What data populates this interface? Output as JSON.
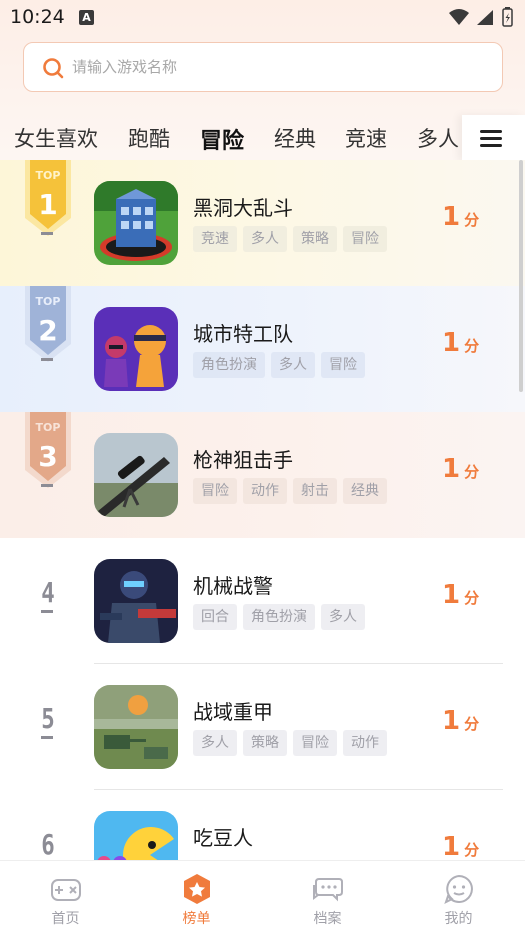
{
  "status_bar": {
    "time": "10:24",
    "app_badge": "A"
  },
  "search": {
    "placeholder": "请输入游戏名称"
  },
  "tabs": [
    {
      "label": "女生喜欢",
      "active": false
    },
    {
      "label": "跑酷",
      "active": false
    },
    {
      "label": "冒险",
      "active": true
    },
    {
      "label": "经典",
      "active": false
    },
    {
      "label": "竞速",
      "active": false
    },
    {
      "label": "多人",
      "active": false
    }
  ],
  "games": [
    {
      "rank": "1",
      "name": "黑洞大乱斗",
      "tags": [
        "竞速",
        "多人",
        "策略",
        "冒险"
      ],
      "score": "1",
      "score_unit": "分",
      "medal": "TOP"
    },
    {
      "rank": "2",
      "name": "城市特工队",
      "tags": [
        "角色扮演",
        "多人",
        "冒险"
      ],
      "score": "1",
      "score_unit": "分",
      "medal": "TOP"
    },
    {
      "rank": "3",
      "name": "枪神狙击手",
      "tags": [
        "冒险",
        "动作",
        "射击",
        "经典"
      ],
      "score": "1",
      "score_unit": "分",
      "medal": "TOP"
    },
    {
      "rank": "4",
      "name": "机械战警",
      "tags": [
        "回合",
        "角色扮演",
        "多人"
      ],
      "score": "1",
      "score_unit": "分"
    },
    {
      "rank": "5",
      "name": "战域重甲",
      "tags": [
        "多人",
        "策略",
        "冒险",
        "动作"
      ],
      "score": "1",
      "score_unit": "分"
    },
    {
      "rank": "6",
      "name": "吃豆人",
      "tags": [],
      "score": "1",
      "score_unit": "分"
    }
  ],
  "bottom_nav": [
    {
      "label": "首页",
      "icon": "gamepad-icon",
      "active": false
    },
    {
      "label": "榜单",
      "icon": "ranking-icon",
      "active": true
    },
    {
      "label": "档案",
      "icon": "chat-bubbles-icon",
      "active": false
    },
    {
      "label": "我的",
      "icon": "smile-chat-icon",
      "active": false
    }
  ],
  "colors": {
    "accent": "#f07b3c",
    "gold": "#f5c23a",
    "silver": "#9fb3d8",
    "bronze": "#e3a889",
    "muted": "#a0a0a8"
  }
}
